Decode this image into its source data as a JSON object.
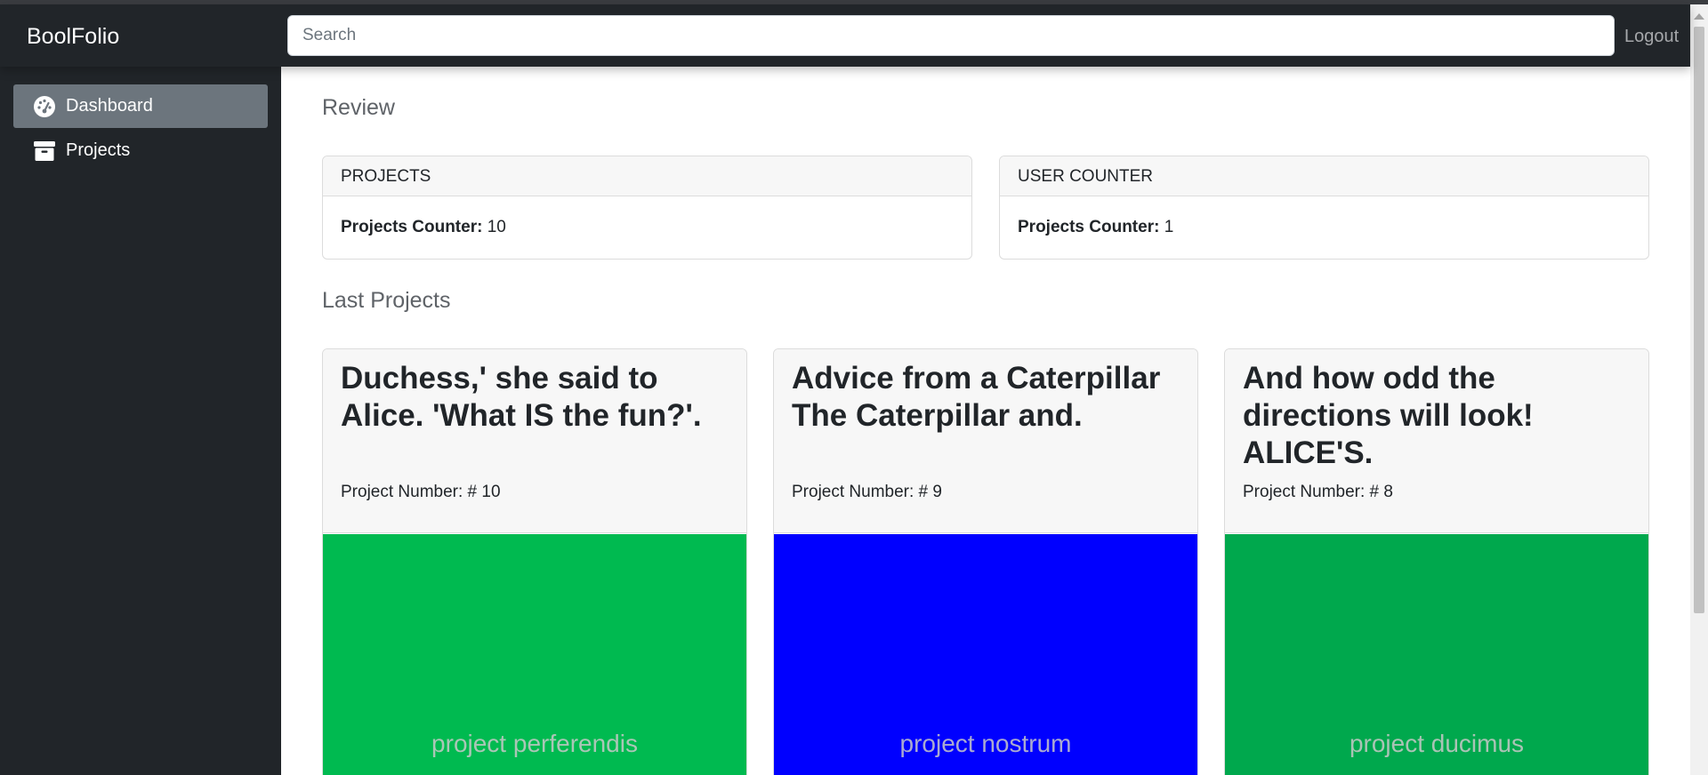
{
  "app": {
    "brand": "BoolFolio"
  },
  "header": {
    "search_placeholder": "Search",
    "logout_label": "Logout"
  },
  "sidebar": {
    "items": [
      {
        "label": "Dashboard",
        "icon": "gauge-icon",
        "active": true
      },
      {
        "label": "Projects",
        "icon": "archive-box-icon",
        "active": false
      }
    ]
  },
  "review": {
    "title": "Review",
    "cards": [
      {
        "header": "PROJECTS",
        "label": "Projects Counter:",
        "value": "10"
      },
      {
        "header": "USER COUNTER",
        "label": "Projects Counter:",
        "value": "1"
      }
    ]
  },
  "last_projects": {
    "title": "Last Projects",
    "items": [
      {
        "title": "Duchess,' she said to Alice. 'What IS the fun?'.",
        "number": "Project Number: # 10",
        "image_text": "project perferendis",
        "color": "#00ba50"
      },
      {
        "title": "Advice from a Caterpillar The Caterpillar and.",
        "number": "Project Number: # 9",
        "image_text": "project nostrum",
        "color": "#0000ff"
      },
      {
        "title": "And how odd the directions will look! ALICE'S.",
        "number": "Project Number: # 8",
        "image_text": "project ducimus",
        "color": "#00a84d"
      }
    ]
  }
}
